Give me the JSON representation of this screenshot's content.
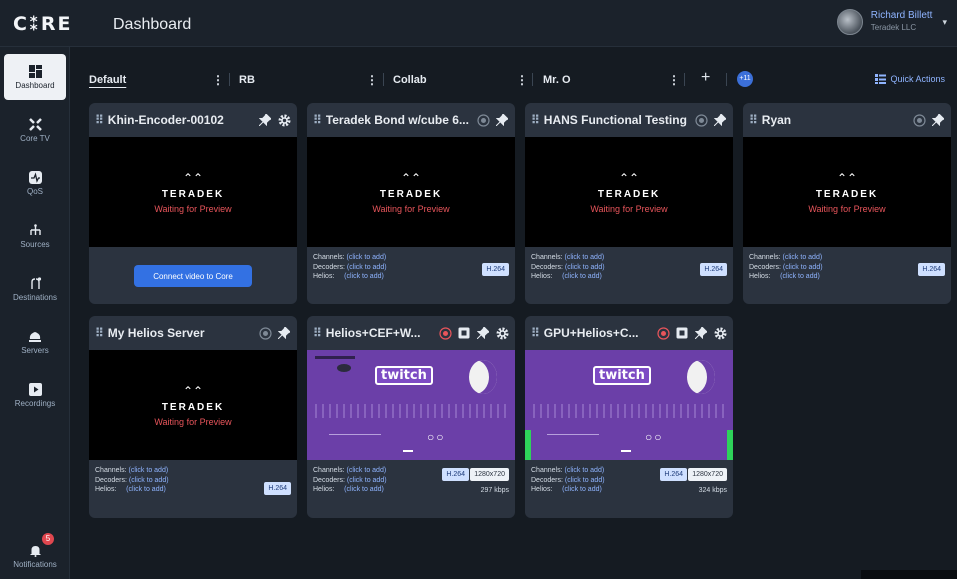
{
  "app": {
    "logo": "C⁑RE",
    "page_title": "Dashboard"
  },
  "user": {
    "name": "Richard Billett",
    "org": "Teradek LLC"
  },
  "sidebar": {
    "items": [
      {
        "label": "Dashboard",
        "icon": "dashboard-icon",
        "active": true
      },
      {
        "label": "Core TV",
        "icon": "core-tv-icon"
      },
      {
        "label": "QoS",
        "icon": "qos-icon"
      },
      {
        "label": "Sources",
        "icon": "sources-icon"
      },
      {
        "label": "Destinations",
        "icon": "destinations-icon"
      },
      {
        "label": "Servers",
        "icon": "servers-icon"
      },
      {
        "label": "Recordings",
        "icon": "recordings-icon"
      }
    ],
    "notifications": {
      "label": "Notifications",
      "count": "5"
    }
  },
  "tabs": [
    {
      "label": "Default",
      "active": true
    },
    {
      "label": "RB"
    },
    {
      "label": "Collab"
    },
    {
      "label": "Mr. O"
    }
  ],
  "more_tabs": "+11",
  "quick_actions": "Quick Actions",
  "common": {
    "brand": "TERADEK",
    "waiting": "Waiting for Preview",
    "channels": "Channels:",
    "decoders": "Decoders:",
    "helios": "Helios:",
    "click_to_add": "(click to add)",
    "codec": "H.264",
    "connect": "Connect video to Core",
    "twitch": "twitch"
  },
  "cards": [
    {
      "title": "Khin-Encoder-00102"
    },
    {
      "title": "Teradek Bond w/cube 6..."
    },
    {
      "title": "HANS Functional Testing"
    },
    {
      "title": "Ryan"
    },
    {
      "title": "My Helios Server"
    },
    {
      "title": "Helios+CEF+W...",
      "resolution": "1280x720",
      "bitrate": "297 kbps"
    },
    {
      "title": "GPU+Helios+C...",
      "resolution": "1280x720",
      "bitrate": "324 kbps"
    }
  ],
  "colors": {
    "accent": "#3371e3",
    "recording": "#e8555b",
    "background": "#151b22",
    "card": "#2b333f"
  }
}
